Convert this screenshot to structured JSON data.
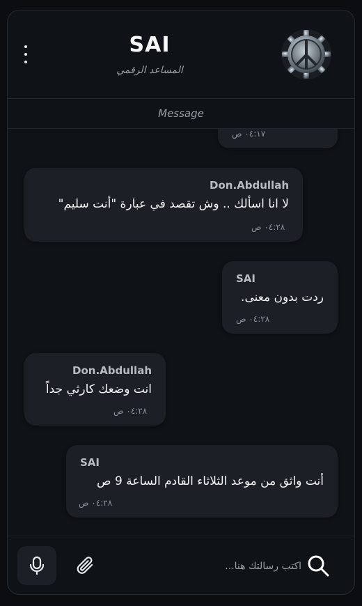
{
  "header": {
    "title": "SAI",
    "subtitle": "المساعد الرقمي",
    "avatar_icon": "gear-peace-emblem-icon",
    "menu_icon": "vertical-dots-icon"
  },
  "message_bar": {
    "label": "Message"
  },
  "messages": [
    {
      "sender": "",
      "text": "",
      "time": "٠٤:١٧ ص"
    },
    {
      "sender": "Don.Abdullah",
      "text": "لا انا اسألك .. وش تقصد في عبارة \"أنت سليم\"",
      "time": "٠٤:٢٨ ص"
    },
    {
      "sender": "SAI",
      "text": "ردت بدون معنى.",
      "time": "٠٤:٢٨ ص"
    },
    {
      "sender": "Don.Abdullah",
      "text": "انت وضعك كارثي جداً",
      "time": "٠٤:٢٨ ص"
    },
    {
      "sender": "SAI",
      "text": "أنت واثق من موعد الثلاثاء القادم الساعة 9 ص",
      "time": "٠٤:٢٨ ص"
    }
  ],
  "composer": {
    "placeholder": "اكتب رسالتك هنا...",
    "value": "",
    "mic_icon": "microphone-icon",
    "attach_icon": "paperclip-icon",
    "search_icon": "search-icon"
  }
}
